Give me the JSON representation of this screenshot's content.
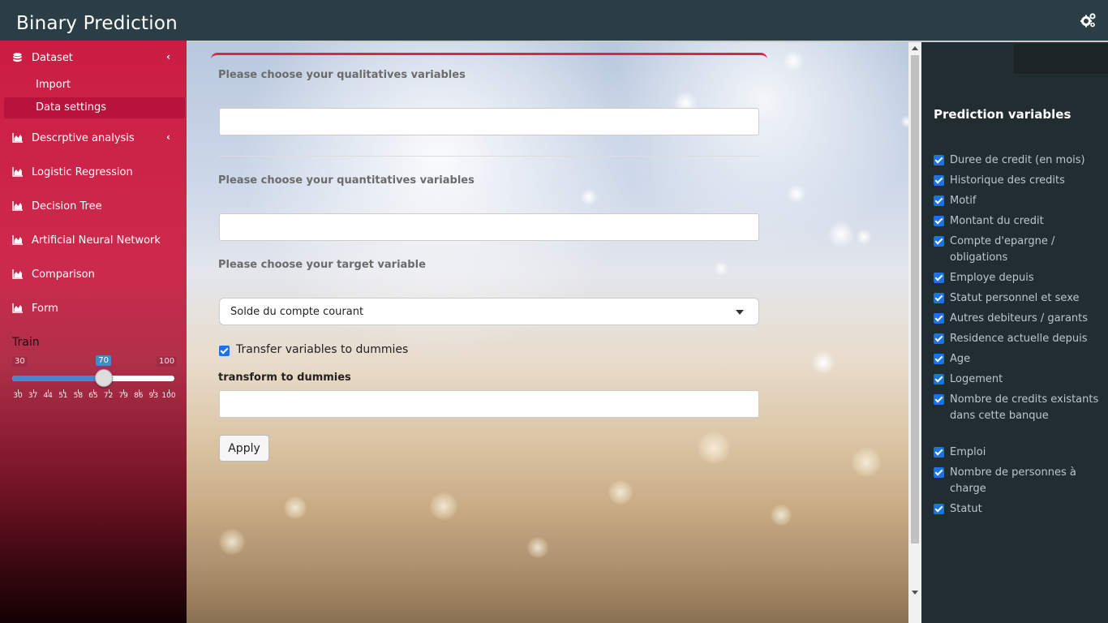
{
  "header": {
    "title": "Binary Prediction",
    "settings_icon": "gears-icon"
  },
  "sidebar": {
    "items": [
      {
        "label": "Dataset",
        "icon": "database-icon",
        "expandable": true
      },
      {
        "label": "Descrptive analysis",
        "icon": "chart-area-icon",
        "expandable": true
      },
      {
        "label": "Logistic Regression",
        "icon": "chart-area-icon"
      },
      {
        "label": "Decision Tree",
        "icon": "chart-area-icon"
      },
      {
        "label": "Artificial Neural Network",
        "icon": "chart-area-icon"
      },
      {
        "label": "Comparison",
        "icon": "chart-area-icon"
      },
      {
        "label": "Form",
        "icon": "chart-area-icon"
      }
    ],
    "subitems": [
      {
        "label": "Import",
        "active": false
      },
      {
        "label": "Data settings",
        "active": true
      }
    ],
    "train": {
      "label": "Train",
      "min": "30",
      "max": "100",
      "value": "70",
      "ticks": [
        "30",
        "37",
        "44",
        "51",
        "58",
        "65",
        "72",
        "79",
        "86",
        "93",
        "100"
      ]
    }
  },
  "main": {
    "qualitative_label": "Please choose your qualitatives variables",
    "qualitative_value": "",
    "quantitative_label": "Please choose your quantitatives variables",
    "quantitative_value": "",
    "target_label": "Please choose your target variable",
    "target_value": "Solde du compte courant",
    "dummies_checkbox_label": "Transfer variables to dummies",
    "dummies_checked": true,
    "transform_label": "transform to dummies",
    "transform_value": "",
    "apply_label": "Apply"
  },
  "right_panel": {
    "title": "Prediction variables",
    "variables": [
      "Duree de credit (en mois)",
      "Historique des credits",
      "Motif",
      "Montant du credit",
      "Compte d'epargne / obligations",
      "Employe depuis",
      "Statut personnel et sexe",
      "Autres debiteurs / garants",
      "Residence actuelle depuis",
      "Age",
      "Logement",
      "Nombre de credits existants dans cette banque",
      "Emploi",
      "Nombre de personnes à charge",
      "Statut"
    ]
  },
  "colors": {
    "header_bg": "#2b3e45",
    "sidebar_accent": "#cc1d44",
    "right_panel_bg": "#222d32",
    "slider_blue": "#428bca"
  }
}
